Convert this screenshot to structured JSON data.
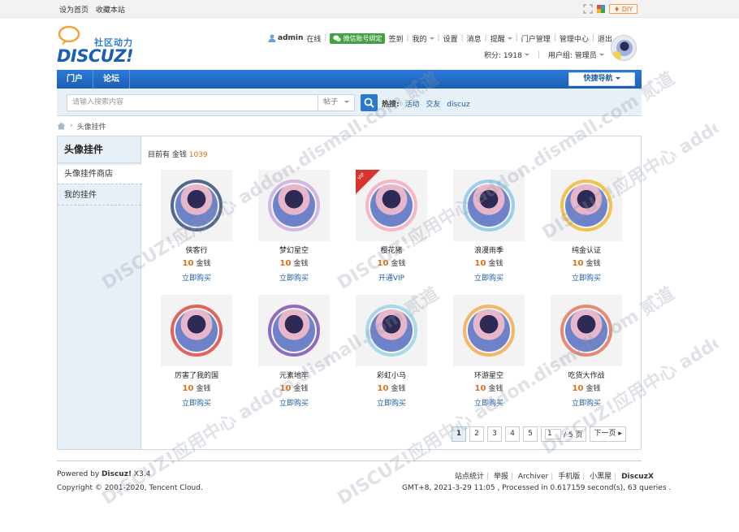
{
  "topbar": {
    "set_home": "设为首页",
    "bookmark": "收藏本站",
    "diy": "DIY"
  },
  "header": {
    "logo_slogan": "社区动力",
    "logo_text": "DISCUZ!",
    "username": "admin",
    "online": "在线",
    "wechat_bind": "微信账号绑定",
    "menu": [
      "签到",
      "我的",
      "设置",
      "消息",
      "提醒",
      "门户管理",
      "管理中心",
      "退出"
    ],
    "points_label": "积分: 1918",
    "group_label": "用户组: 管理员"
  },
  "nav": {
    "items": [
      "门户",
      "论坛"
    ],
    "quick_nav": "快捷导航"
  },
  "search": {
    "placeholder": "请输入搜索内容",
    "type": "帖子",
    "hot_label": "热搜:",
    "hot": [
      "活动",
      "交友",
      "discuz"
    ]
  },
  "breadcrumb": {
    "current": "头像挂件"
  },
  "sidebar": {
    "title": "头像挂件",
    "items": [
      "头像挂件商店",
      "我的挂件"
    ]
  },
  "money": {
    "prefix": "目前有 金钱",
    "value": "1039"
  },
  "items": [
    {
      "name": "侠客行",
      "price": "10",
      "unit": "金钱",
      "action": "立即购买",
      "accent": "#1f3a6b"
    },
    {
      "name": "梦幻星空",
      "price": "10",
      "unit": "金钱",
      "action": "立即购买",
      "accent": "#c7a3e0"
    },
    {
      "name": "樱花猪",
      "price": "10",
      "unit": "金钱",
      "action": "开通VIP",
      "accent": "#f5a3b5",
      "vip": "VIP"
    },
    {
      "name": "浪漫雨季",
      "price": "10",
      "unit": "金钱",
      "action": "立即购买",
      "accent": "#7cc3e8"
    },
    {
      "name": "纯金认证",
      "price": "10",
      "unit": "金钱",
      "action": "立即购买",
      "accent": "#f2b21b"
    },
    {
      "name": "厉害了我的国",
      "price": "10",
      "unit": "金钱",
      "action": "立即购买",
      "accent": "#d9342b"
    },
    {
      "name": "元素地牢",
      "price": "10",
      "unit": "金钱",
      "action": "立即购买",
      "accent": "#6c3fa8"
    },
    {
      "name": "彩虹小马",
      "price": "10",
      "unit": "金钱",
      "action": "立即购买",
      "accent": "#8ecfe8"
    },
    {
      "name": "环游星空",
      "price": "10",
      "unit": "金钱",
      "action": "立即购买",
      "accent": "#f2a43a"
    },
    {
      "name": "吃货大作战",
      "price": "10",
      "unit": "金钱",
      "action": "立即购买",
      "accent": "#e0674b"
    }
  ],
  "pager": {
    "pages": [
      "1",
      "2",
      "3",
      "4",
      "5"
    ],
    "current": "1",
    "jump_value": "1",
    "jump_total": "/ 5 页",
    "next": "下一页"
  },
  "footer": {
    "powered_prefix": "Powered by",
    "powered_brand": "Discuz!",
    "powered_version": "X3.4",
    "copyright": "Copyright © 2001-2020, Tencent Cloud.",
    "links": [
      "站点统计",
      "举报",
      "Archiver",
      "手机版",
      "小黑屋",
      "DiscuzX"
    ],
    "gmt": "GMT+8, 2021-3-29 11:05 , Processed in 0.617159 second(s), 63 queries ."
  },
  "watermark": "DISCUZ!应用中心 addon.dismall.com 贰道"
}
